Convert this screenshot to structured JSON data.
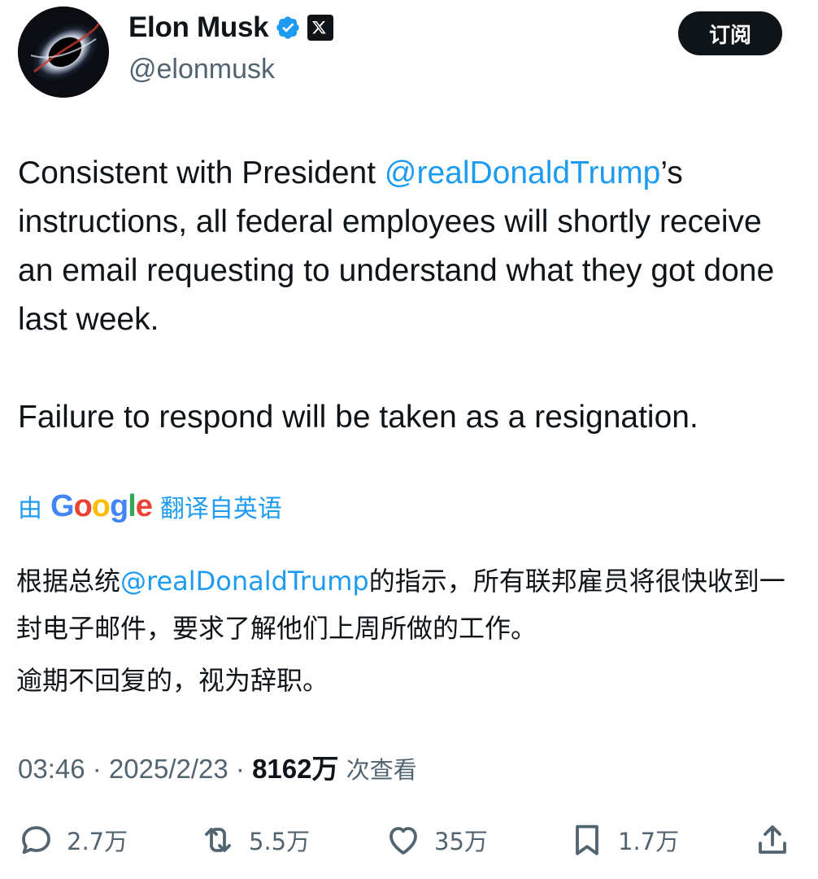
{
  "author": {
    "name": "Elon Musk",
    "handle": "@elonmusk",
    "verified_icon": "verified-badge-icon",
    "affiliation_icon": "x-logo-icon"
  },
  "subscribe_label": "订阅",
  "tweet": {
    "p1_before": "Consistent with President ",
    "p1_mention": "@realDonaldTrump",
    "p1_after": "’s instructions, all federal employees will shortly receive an email requesting to understand what they got done last week.",
    "p2": "Failure to respond will be taken as a resignation."
  },
  "translation": {
    "prefix": "由",
    "brand": "Google",
    "suffix": "翻译自英语",
    "p1_before": "根据总统",
    "p1_mention": "@realDonaldTrump",
    "p1_after": "的指示，所有联邦雇员将很快收到一封电子邮件，要求了解他们上周所做的工作。",
    "p2": "逾期不回复的，视为辞职。"
  },
  "meta": {
    "time": "03:46",
    "sep1": " · ",
    "date": "2025/2/23",
    "sep2": " · ",
    "views": "8162万",
    "views_suffix": " 次查看"
  },
  "actions": {
    "replies": "2.7万",
    "reposts": "5.5万",
    "likes": "35万",
    "bookmarks": "1.7万"
  },
  "colors": {
    "link": "#1d9bf0",
    "text": "#0f1419",
    "muted": "#536471"
  }
}
